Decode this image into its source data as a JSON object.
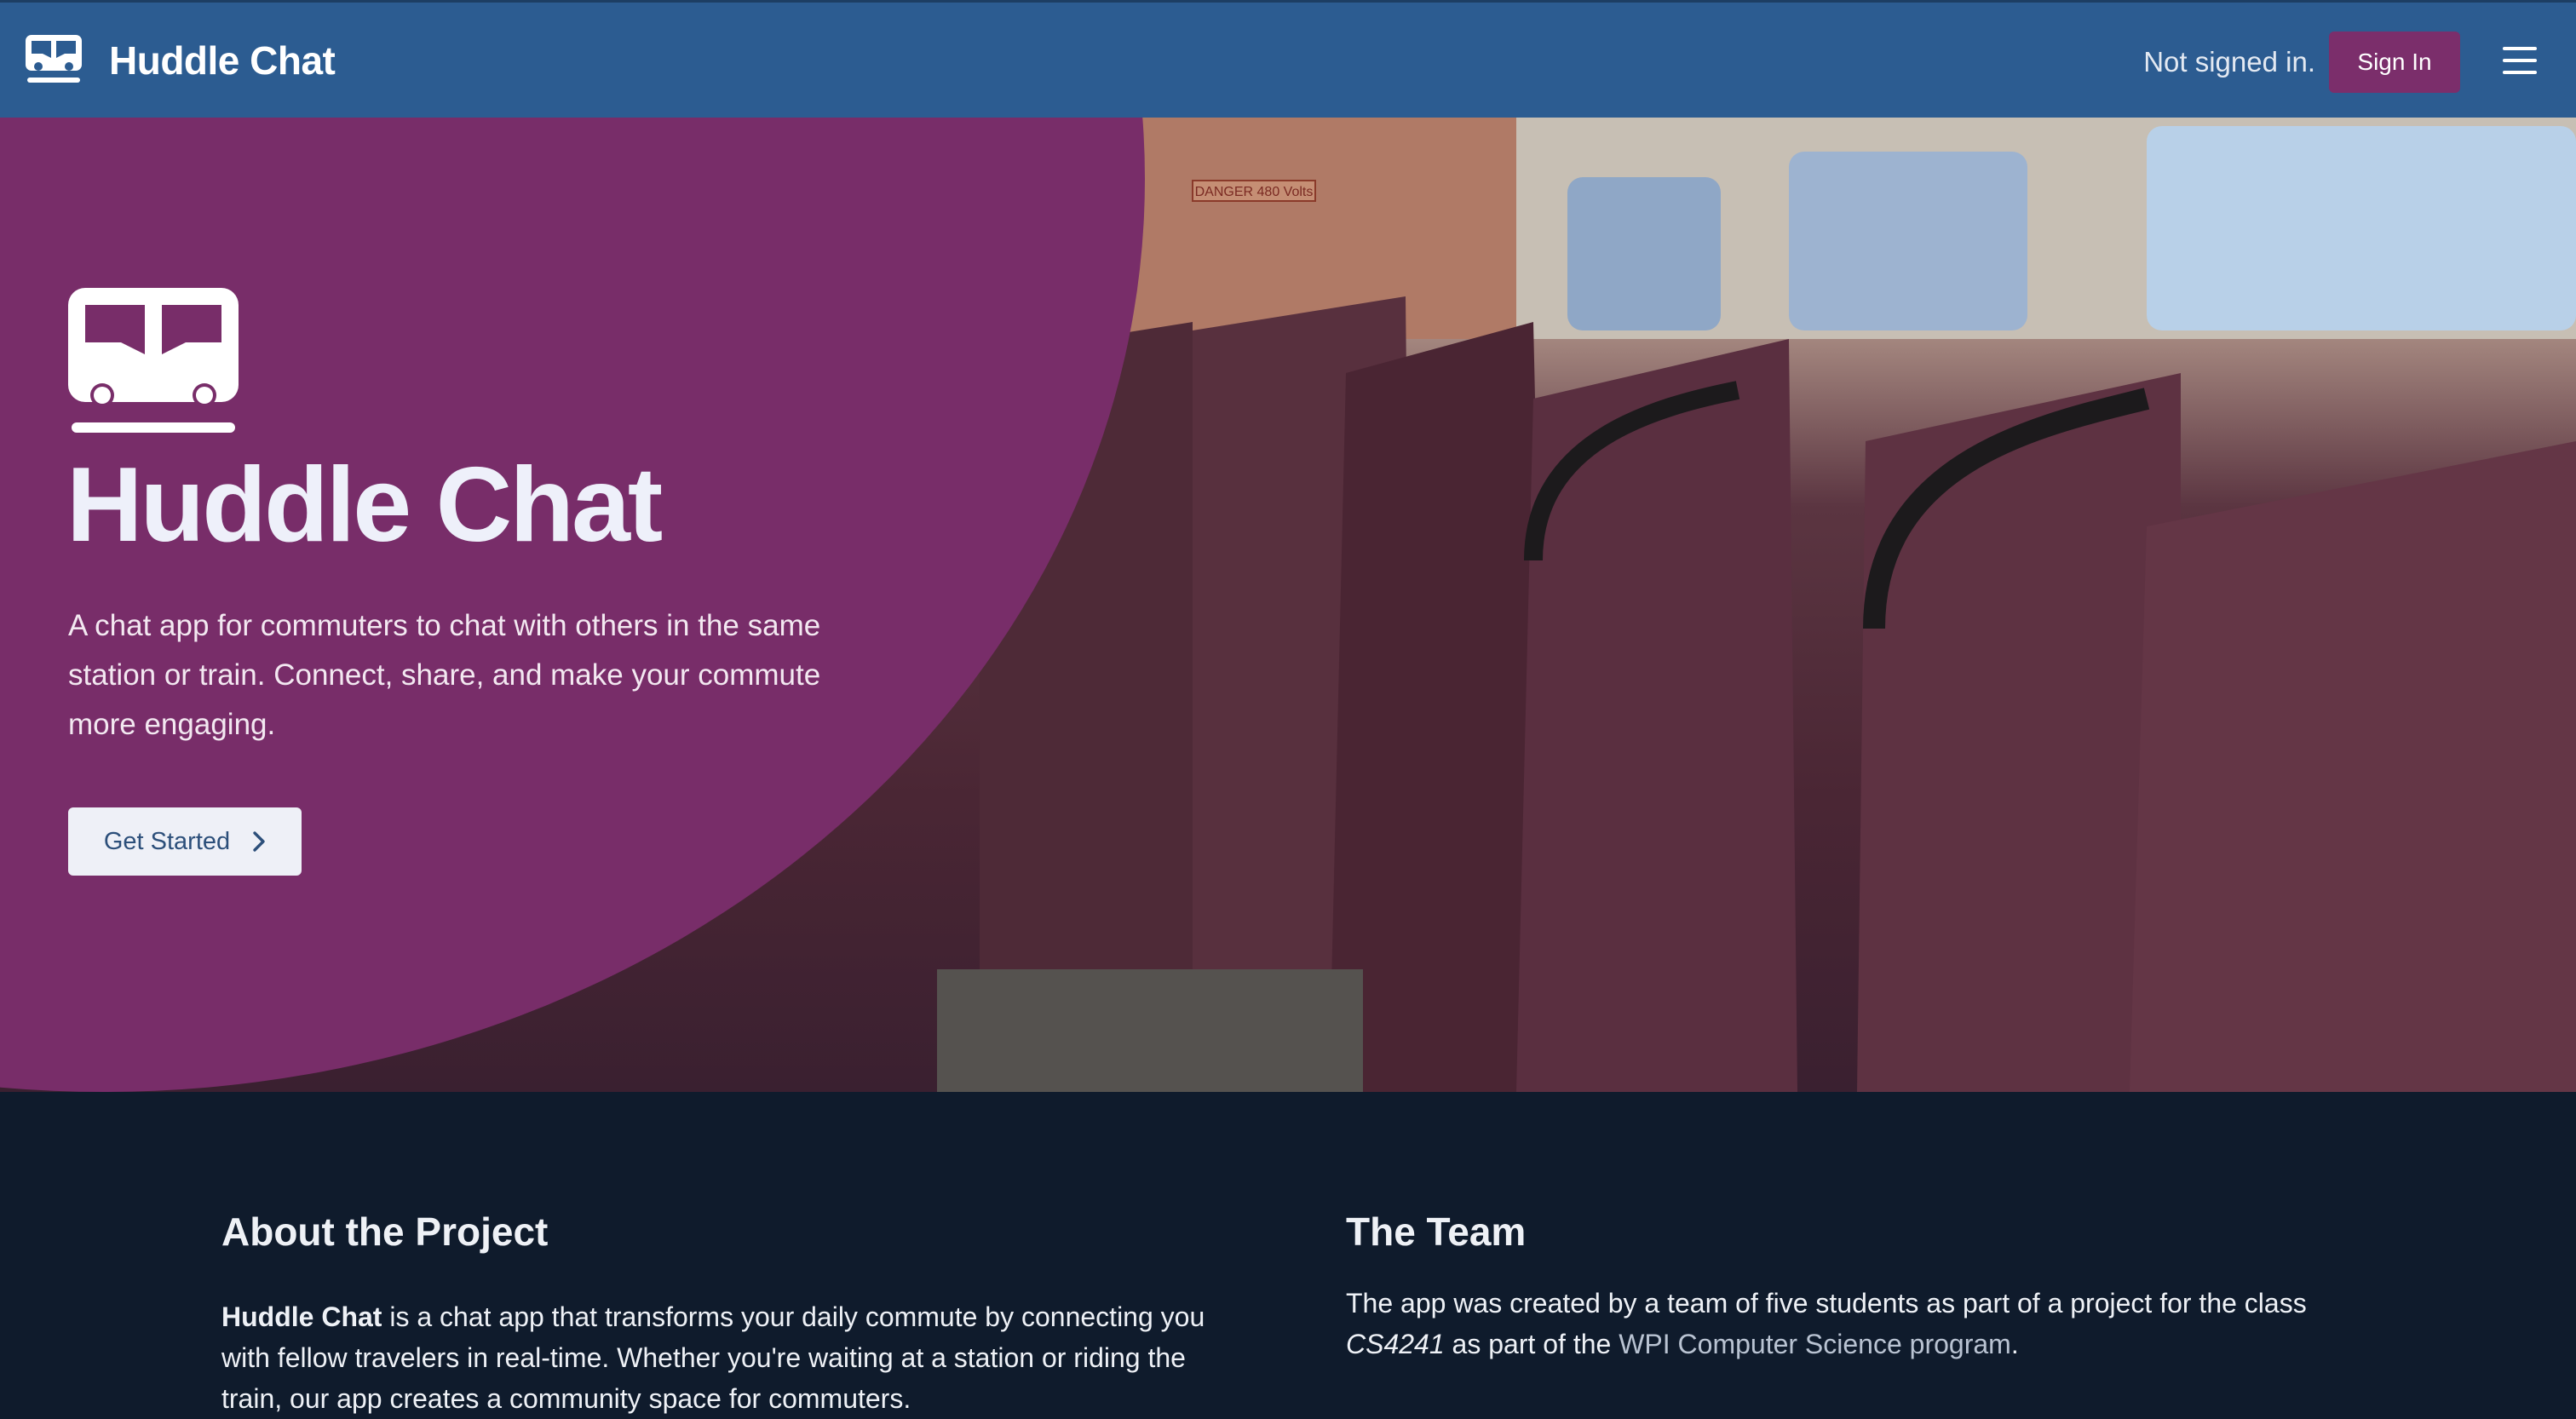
{
  "nav": {
    "brand": "Huddle Chat",
    "status": "Not signed in.",
    "signin_label": "Sign In"
  },
  "hero": {
    "title": "Huddle Chat",
    "description": "A chat app for commuters to chat with others in the same station or train. Connect, share, and make your commute more engaging.",
    "cta_label": "Get Started",
    "photo_sign": "DANGER 480 Volts"
  },
  "about": {
    "title": "About the Project",
    "brand_bold": "Huddle Chat",
    "text": " is a chat app that transforms your daily commute by connecting you with fellow travelers in real-time. Whether you're waiting at a station or riding the train, our app creates a community space for commuters."
  },
  "team": {
    "title": "The Team",
    "text_1": "The app was created by a team of five students as part of a project for the class ",
    "course": "CS4241",
    "text_2": " as part of the ",
    "link_label": "WPI Computer Science program",
    "text_3": "."
  },
  "colors": {
    "nav_bg": "#2c5c91",
    "accent": "#782d69",
    "signin_bg": "#7b2e6b",
    "footer_bg": "#0f1b2c"
  },
  "icons": [
    "train-logo-icon",
    "menu-icon",
    "chevron-right-icon"
  ]
}
